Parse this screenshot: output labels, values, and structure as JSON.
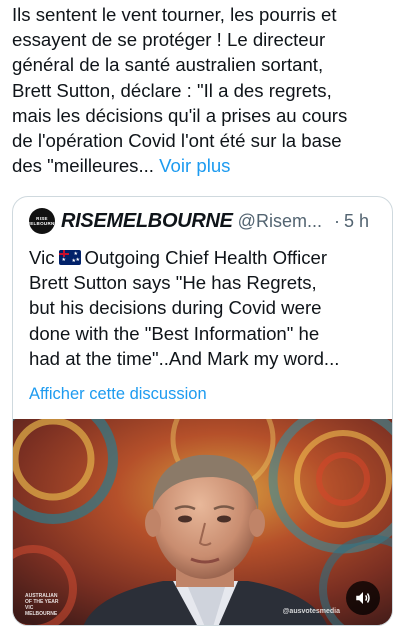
{
  "post": {
    "lines": [
      "Ils sentent le vent tourner, les pourris et",
      "essayent de se protéger ! Le directeur",
      "général de la santé australien sortant,",
      "Brett Sutton, déclare : \"Il a des regrets,",
      "mais les décisions qu'il a prises au cours",
      "de l'opération Covid l'ont été sur la base",
      "des \"meilleures..."
    ],
    "see_more": "Voir plus"
  },
  "quote": {
    "avatar_text": [
      "RISE",
      "MELBOURNE"
    ],
    "display_name": "RISEMELBOURNE",
    "handle": "@Risem...",
    "separator": "·",
    "time": "5 h",
    "line1_before_flag": "Vic",
    "line1_after_flag": "Outgoing Chief Health Officer",
    "lines": [
      "Brett Sutton says \"He has Regrets,",
      "but his decisions during Covid were",
      "done with the \"Best Information\" he",
      "had at the time\"..And Mark my word..."
    ],
    "show_thread": "Afficher cette discussion"
  },
  "media": {
    "watermark_left": [
      "AUSTRALIAN",
      "OF THE YEAR",
      "VIC",
      "MELBOURNE"
    ],
    "watermark_right": "@ausvotesmedia",
    "sound_icon": "speaker-icon"
  }
}
